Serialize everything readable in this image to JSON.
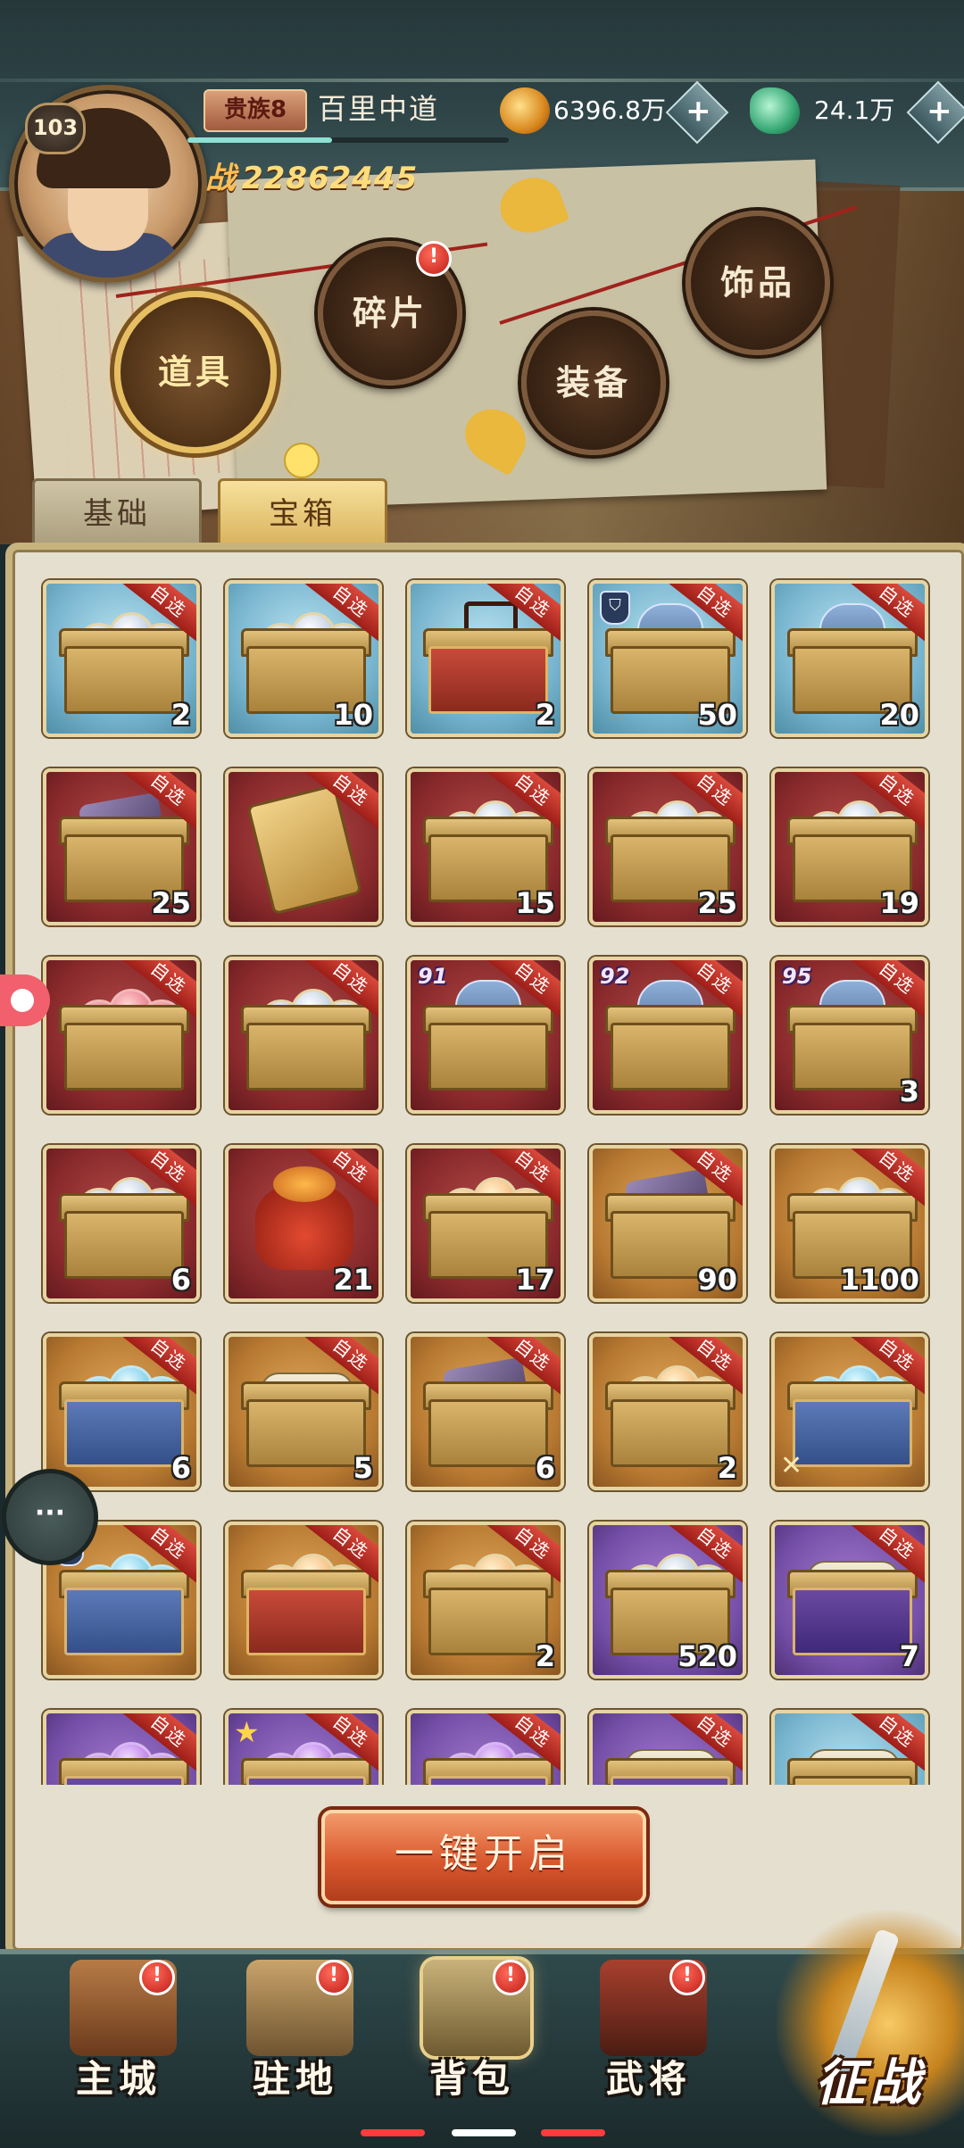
{
  "player": {
    "level": "103",
    "rank": "贵族8",
    "name": "百里中道",
    "power_prefix": "战",
    "power": "22862445",
    "exp_progress": 0.45
  },
  "currencies": [
    {
      "name": "coins",
      "value": "6396.8万",
      "icon": "coin-pile-icon"
    },
    {
      "name": "jade",
      "value": "24.1万",
      "icon": "jade-dragon-icon"
    }
  ],
  "categories": [
    {
      "label": "道具",
      "active": true,
      "notification": false
    },
    {
      "label": "碎片",
      "active": false,
      "notification": true
    },
    {
      "label": "装备",
      "active": false,
      "notification": false
    },
    {
      "label": "饰品",
      "active": false,
      "notification": false
    }
  ],
  "subtabs": [
    {
      "label": "基础",
      "active": false
    },
    {
      "label": "宝箱",
      "active": true
    }
  ],
  "ribbon_text": "自选",
  "items": [
    {
      "bg": "blue",
      "count": "2",
      "box": "chest",
      "content": "gems"
    },
    {
      "bg": "blue",
      "count": "10",
      "box": "chest",
      "content": "orbs"
    },
    {
      "bg": "blue",
      "count": "2",
      "box": "redbox",
      "content": "case"
    },
    {
      "bg": "blue",
      "count": "50",
      "box": "chest",
      "content": "armor",
      "badge": "shield"
    },
    {
      "bg": "blue",
      "count": "20",
      "box": "chest",
      "content": "armor"
    },
    {
      "bg": "red",
      "count": "25",
      "box": "chest",
      "content": "pieces"
    },
    {
      "bg": "red",
      "count": "",
      "box": "card",
      "content": "card"
    },
    {
      "bg": "red",
      "count": "15",
      "box": "chest",
      "content": "orbs"
    },
    {
      "bg": "red",
      "count": "25",
      "box": "chest",
      "content": "orbs"
    },
    {
      "bg": "red",
      "count": "19",
      "box": "chest",
      "content": "orbs"
    },
    {
      "bg": "red",
      "count": "",
      "box": "chest",
      "content": "pink"
    },
    {
      "bg": "red",
      "count": "",
      "box": "chest",
      "content": "orbs"
    },
    {
      "bg": "red",
      "count": "",
      "box": "chest",
      "content": "armor",
      "level": "91"
    },
    {
      "bg": "red",
      "count": "",
      "box": "chest",
      "content": "armor",
      "level": "92"
    },
    {
      "bg": "red",
      "count": "3",
      "box": "chest",
      "content": "armor",
      "level": "95"
    },
    {
      "bg": "red",
      "count": "6",
      "box": "chest",
      "content": "orbs"
    },
    {
      "bg": "red",
      "count": "21",
      "box": "bag",
      "content": "bag"
    },
    {
      "bg": "red",
      "count": "17",
      "box": "chest",
      "content": "fire"
    },
    {
      "bg": "gold",
      "count": "90",
      "box": "chest",
      "content": "pieces"
    },
    {
      "bg": "gold",
      "count": "1100",
      "box": "chest",
      "content": "orbs"
    },
    {
      "bg": "gold",
      "count": "6",
      "box": "bluebox",
      "content": "cyan"
    },
    {
      "bg": "gold",
      "count": "5",
      "box": "chest",
      "content": "scrolls"
    },
    {
      "bg": "gold",
      "count": "6",
      "box": "chest",
      "content": "weapons"
    },
    {
      "bg": "gold",
      "count": "2",
      "box": "chest",
      "content": "warm"
    },
    {
      "bg": "gold",
      "count": "",
      "box": "bluebox",
      "content": "cyan",
      "badge": "swords"
    },
    {
      "bg": "gold",
      "count": "",
      "box": "bluebox",
      "content": "cyan",
      "badge": "shield"
    },
    {
      "bg": "gold",
      "count": "",
      "box": "redbox",
      "content": "fire"
    },
    {
      "bg": "gold",
      "count": "2",
      "box": "chest",
      "content": "warm"
    },
    {
      "bg": "purple",
      "count": "520",
      "box": "chest",
      "content": "orbs"
    },
    {
      "bg": "purple",
      "count": "7",
      "box": "purplebox",
      "content": "scrolls"
    },
    {
      "bg": "purple",
      "count": "",
      "box": "purplebox",
      "content": "violet"
    },
    {
      "bg": "purple",
      "count": "",
      "box": "purplebox",
      "content": "violet",
      "badge": "star"
    },
    {
      "bg": "purple",
      "count": "",
      "box": "purplebox",
      "content": "violet"
    },
    {
      "bg": "purple",
      "count": "",
      "box": "purplebox",
      "content": "scrolls"
    },
    {
      "bg": "blue",
      "count": "",
      "box": "chest",
      "content": "scrolls"
    }
  ],
  "open_all_label": "一键开启",
  "nav": [
    {
      "label": "主城",
      "notification": true,
      "icon": "city-icon"
    },
    {
      "label": "驻地",
      "notification": true,
      "icon": "camp-icon"
    },
    {
      "label": "背包",
      "notification": true,
      "icon": "bag-icon",
      "active": true
    },
    {
      "label": "武将",
      "notification": true,
      "icon": "general-icon"
    }
  ],
  "battle_label": "征战",
  "chat_icon": "chat-bubble-icon",
  "colors": {
    "notification": "#d6231b",
    "ribbon": "#c0302a",
    "accent_gold": "#e7bf63"
  }
}
